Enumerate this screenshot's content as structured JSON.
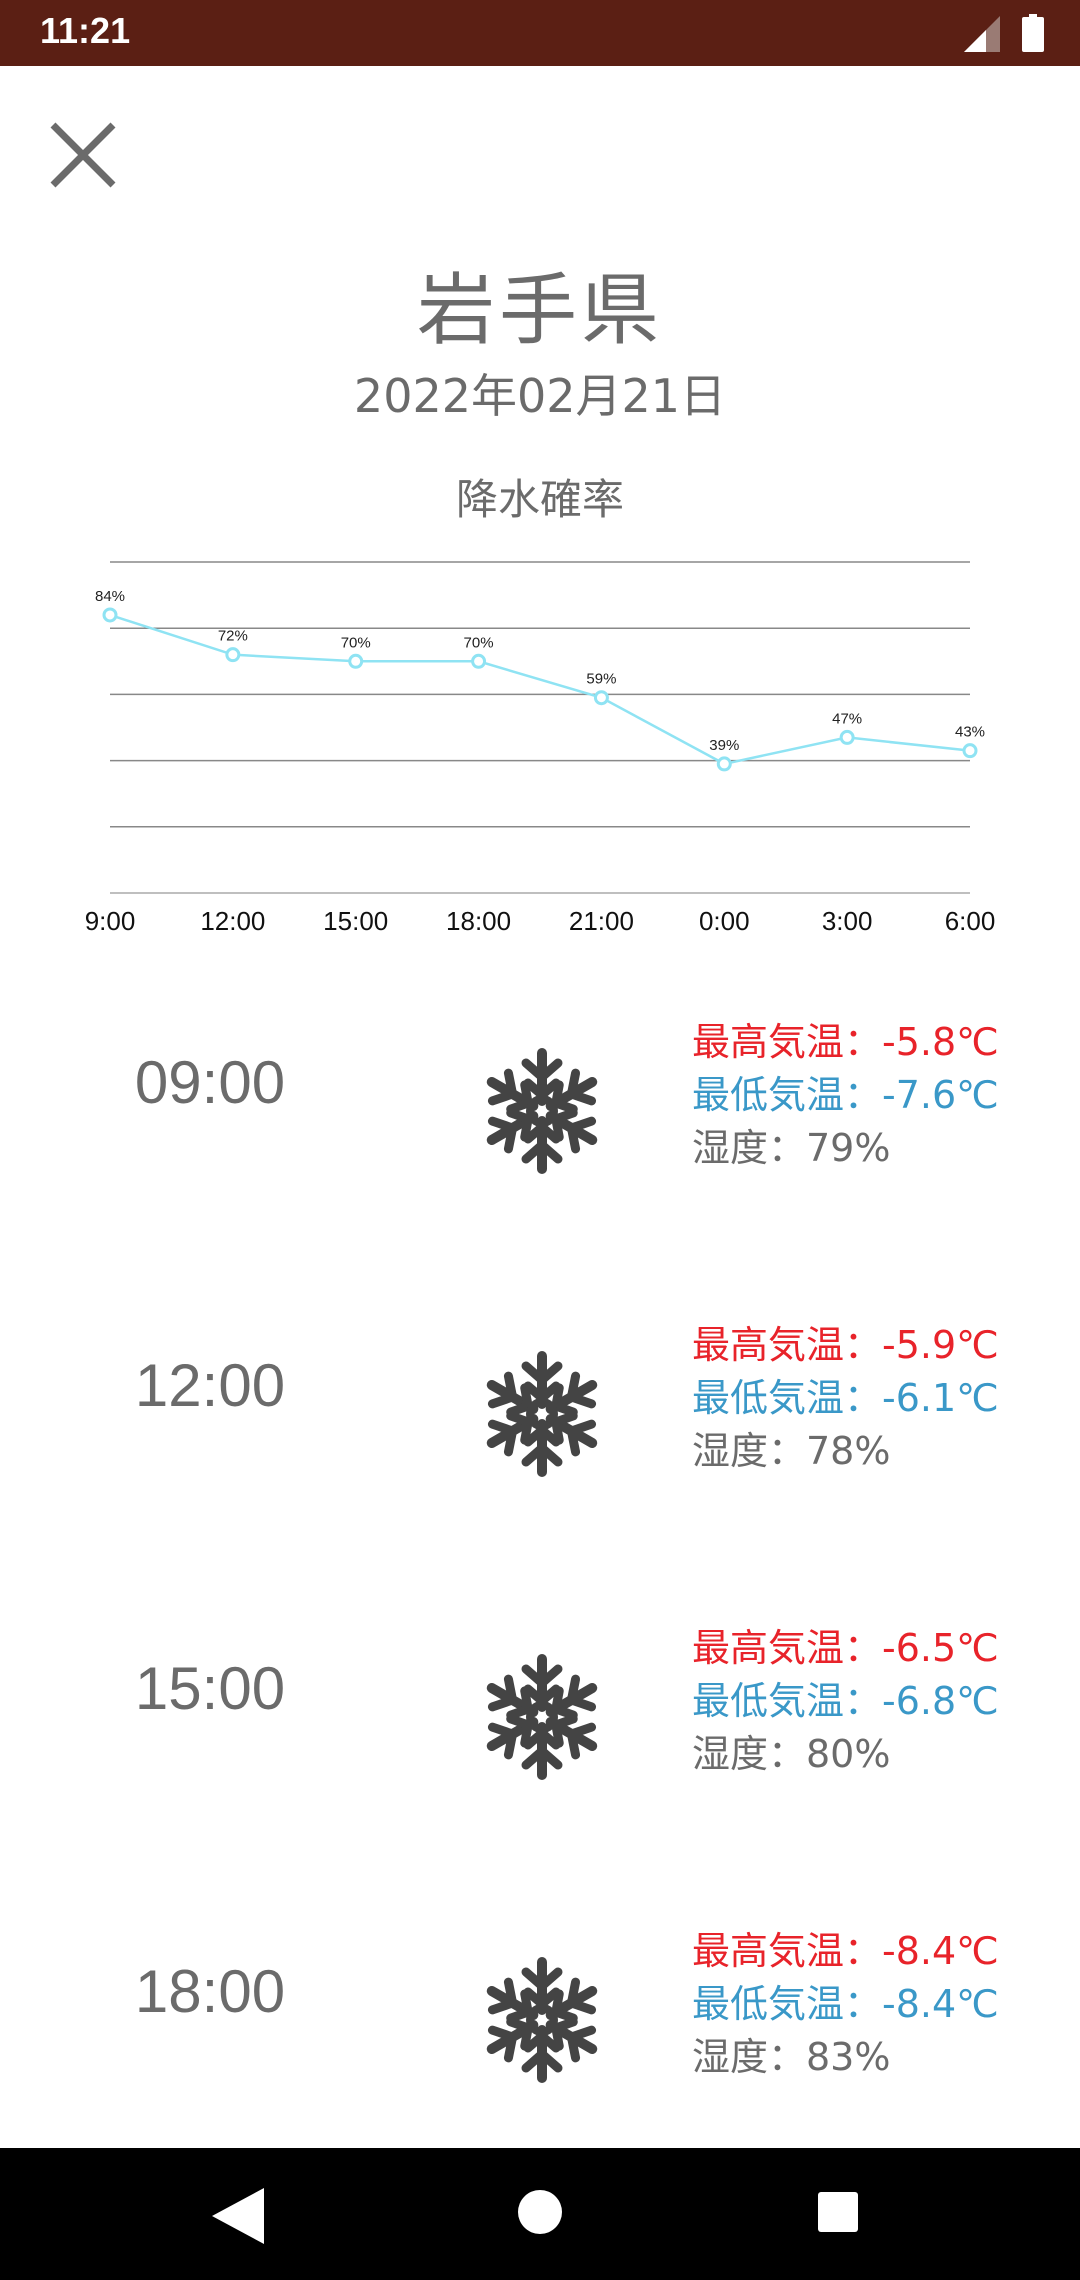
{
  "status_bar": {
    "time": "11:21"
  },
  "header": {
    "prefecture": "岩手県",
    "date": "2022年02月21日"
  },
  "chart_data": {
    "type": "line",
    "title": "降水確率",
    "categories": [
      "9:00",
      "12:00",
      "15:00",
      "18:00",
      "21:00",
      "0:00",
      "3:00",
      "6:00"
    ],
    "values": [
      84,
      72,
      70,
      70,
      59,
      39,
      47,
      43
    ],
    "value_labels": [
      "84%",
      "72%",
      "70%",
      "70%",
      "59%",
      "39%",
      "47%",
      "43%"
    ],
    "ylim": [
      0,
      100
    ],
    "grid": true,
    "line_color": "#8fe3f3"
  },
  "forecast": [
    {
      "time": "09:00",
      "icon": "snowflake-icon",
      "max": "最高気温：-5.8℃",
      "min": "最低気温：-7.6℃",
      "humidity": "湿度：79%"
    },
    {
      "time": "12:00",
      "icon": "snowflake-icon",
      "max": "最高気温：-5.9℃",
      "min": "最低気温：-6.1℃",
      "humidity": "湿度：78%"
    },
    {
      "time": "15:00",
      "icon": "snowflake-icon",
      "max": "最高気温：-6.5℃",
      "min": "最低気温：-6.8℃",
      "humidity": "湿度：80%"
    },
    {
      "time": "18:00",
      "icon": "snowflake-icon",
      "max": "最高気温：-8.4℃",
      "min": "最低気温：-8.4℃",
      "humidity": "湿度：83%"
    }
  ],
  "colors": {
    "status_bar": "#5b1f14",
    "max_temp": "#e8232a",
    "min_temp": "#3a98c8",
    "text_gray": "#6b6b6b"
  }
}
